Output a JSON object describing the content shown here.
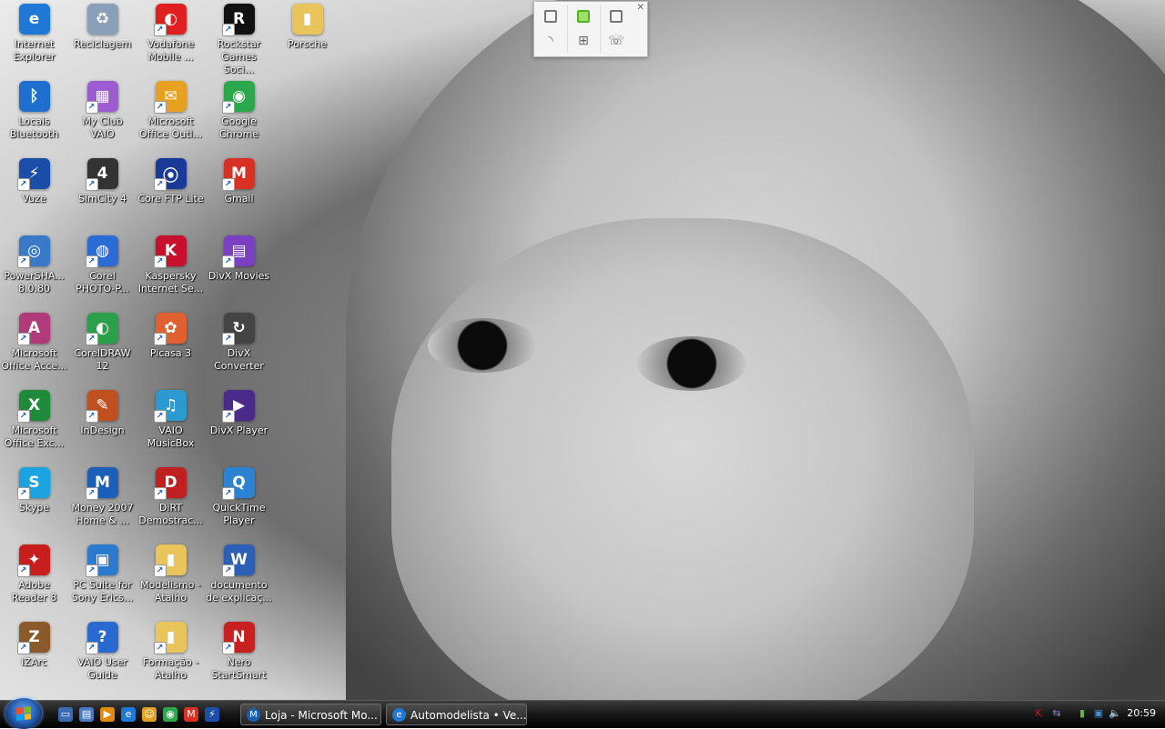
{
  "desktop": {
    "icons": [
      {
        "label": "Internet\nExplorer",
        "icon": "internet-explorer-icon",
        "glyph": "e",
        "color": "#1f77d6",
        "shortcut": false
      },
      {
        "label": "Reciclagem",
        "icon": "recycle-bin-icon",
        "glyph": "♻",
        "color": "#8aa0b8",
        "shortcut": false
      },
      {
        "label": "Vodafone\nMobile ...",
        "icon": "vodafone-icon",
        "glyph": "◐",
        "color": "#e02020",
        "shortcut": true
      },
      {
        "label": "Rockstar\nGames Soci...",
        "icon": "rockstar-icon",
        "glyph": "R",
        "color": "#111111",
        "shortcut": true
      },
      {
        "label": "Porsche",
        "icon": "folder-icon",
        "glyph": "▮",
        "color": "#e8c45a",
        "shortcut": false
      },
      {
        "label": "Locais\nBluetooth",
        "icon": "bluetooth-icon",
        "glyph": "ᛒ",
        "color": "#1e6fd0",
        "shortcut": false
      },
      {
        "label": "My Club\nVAIO",
        "icon": "my-club-vaio-icon",
        "glyph": "▦",
        "color": "#9c5bd0",
        "shortcut": true
      },
      {
        "label": "Microsoft\nOffice Outl...",
        "icon": "outlook-icon",
        "glyph": "✉",
        "color": "#e8a020",
        "shortcut": true
      },
      {
        "label": "Google\nChrome",
        "icon": "chrome-icon",
        "glyph": "◉",
        "color": "#2aa84a",
        "shortcut": true
      },
      {
        "label": "Vuze",
        "icon": "vuze-icon",
        "glyph": "⚡",
        "color": "#1b4ea8",
        "shortcut": true
      },
      {
        "label": "SimCity 4",
        "icon": "simcity-icon",
        "glyph": "4",
        "color": "#333333",
        "shortcut": true
      },
      {
        "label": "Core FTP Lite",
        "icon": "core-ftp-icon",
        "glyph": "⦿",
        "color": "#1a3a9a",
        "shortcut": true
      },
      {
        "label": "Gmail",
        "icon": "gmail-icon",
        "glyph": "M",
        "color": "#d93025",
        "shortcut": true
      },
      {
        "label": "PowerSHA...\n8.0.80",
        "icon": "powershare-icon",
        "glyph": "◎",
        "color": "#3a78c8",
        "shortcut": true
      },
      {
        "label": "Corel\nPHOTO-P...",
        "icon": "corel-photo-icon",
        "glyph": "◍",
        "color": "#2b6bd6",
        "shortcut": true
      },
      {
        "label": "Kaspersky\nInternet Se...",
        "icon": "kaspersky-icon",
        "glyph": "K",
        "color": "#c8102e",
        "shortcut": true
      },
      {
        "label": "DivX Movies",
        "icon": "divx-movies-icon",
        "glyph": "▤",
        "color": "#7b3fc2",
        "shortcut": true
      },
      {
        "label": "Microsoft\nOffice Acce...",
        "icon": "access-icon",
        "glyph": "A",
        "color": "#b03a7a",
        "shortcut": true
      },
      {
        "label": "CorelDRAW\n12",
        "icon": "coreldraw-icon",
        "glyph": "◐",
        "color": "#2aa04a",
        "shortcut": true
      },
      {
        "label": "Picasa 3",
        "icon": "picasa-icon",
        "glyph": "✿",
        "color": "#e06030",
        "shortcut": true
      },
      {
        "label": "DivX\nConverter",
        "icon": "divx-converter-icon",
        "glyph": "↻",
        "color": "#444444",
        "shortcut": true
      },
      {
        "label": "Microsoft\nOffice Exc...",
        "icon": "excel-icon",
        "glyph": "X",
        "color": "#1f8a3a",
        "shortcut": true
      },
      {
        "label": "InDesign",
        "icon": "indesign-icon",
        "glyph": "✎",
        "color": "#c05020",
        "shortcut": true
      },
      {
        "label": "VAIO\nMusicBox",
        "icon": "vaio-musicbox-icon",
        "glyph": "♫",
        "color": "#2a9ad0",
        "shortcut": true
      },
      {
        "label": "DivX Player",
        "icon": "divx-player-icon",
        "glyph": "▶",
        "color": "#4a2a8a",
        "shortcut": true
      },
      {
        "label": "Skype",
        "icon": "skype-icon",
        "glyph": "S",
        "color": "#1ba3e0",
        "shortcut": true
      },
      {
        "label": "Money 2007\nHome & ...",
        "icon": "money-icon",
        "glyph": "M",
        "color": "#1b5fb8",
        "shortcut": true
      },
      {
        "label": "DiRT\nDemostrac...",
        "icon": "dirt-icon",
        "glyph": "D",
        "color": "#c02020",
        "shortcut": true
      },
      {
        "label": "QuickTime\nPlayer",
        "icon": "quicktime-icon",
        "glyph": "Q",
        "color": "#2a82d0",
        "shortcut": true
      },
      {
        "label": "Adobe\nReader 8",
        "icon": "adobe-reader-icon",
        "glyph": "✦",
        "color": "#c81e1e",
        "shortcut": true
      },
      {
        "label": "PC Suite for\nSony Erics...",
        "icon": "pc-suite-icon",
        "glyph": "▣",
        "color": "#2a7ad0",
        "shortcut": true
      },
      {
        "label": "Modelismo -\nAtalho",
        "icon": "folder-shortcut-icon",
        "glyph": "▮",
        "color": "#e8c45a",
        "shortcut": true
      },
      {
        "label": "documento\nde explicaç...",
        "icon": "word-document-icon",
        "glyph": "W",
        "color": "#2b5fb8",
        "shortcut": true
      },
      {
        "label": "IZArc",
        "icon": "izarc-icon",
        "glyph": "Z",
        "color": "#8a5a2a",
        "shortcut": true
      },
      {
        "label": "VAIO User\nGuide",
        "icon": "vaio-guide-icon",
        "glyph": "?",
        "color": "#2a6ad0",
        "shortcut": true
      },
      {
        "label": "Formação -\nAtalho",
        "icon": "folder-shortcut-icon",
        "glyph": "▮",
        "color": "#e8c45a",
        "shortcut": true
      },
      {
        "label": "Nero\nStartSmart",
        "icon": "nero-icon",
        "glyph": "N",
        "color": "#c82020",
        "shortcut": true
      }
    ]
  },
  "gadget": {
    "top_icons": [
      "display-icon",
      "display-active-icon",
      "display-icon"
    ],
    "bottom_icons": [
      "wifi-icon",
      "network-icon",
      "phone-icon"
    ],
    "close_glyph": "✕",
    "accent_color": "#52b51e"
  },
  "taskbar": {
    "quick_launch": [
      {
        "icon": "show-desktop-icon",
        "color": "#3a6ab0",
        "glyph": "▭"
      },
      {
        "icon": "switch-windows-icon",
        "color": "#4a7ac0",
        "glyph": "▤"
      },
      {
        "icon": "media-player-icon",
        "color": "#e08a10",
        "glyph": "▶"
      },
      {
        "icon": "internet-explorer-icon",
        "color": "#1f77d6",
        "glyph": "e"
      },
      {
        "icon": "messenger-icon",
        "color": "#e0a020",
        "glyph": "☺"
      },
      {
        "icon": "chrome-icon",
        "color": "#2aa84a",
        "glyph": "◉"
      },
      {
        "icon": "gmail-icon",
        "color": "#d93025",
        "glyph": "M"
      },
      {
        "icon": "vuze-icon",
        "color": "#1b4ea8",
        "glyph": "⚡"
      }
    ],
    "windows": [
      {
        "label": "Loja - Microsoft Mo...",
        "icon": "money-icon",
        "color": "#1b5fb8",
        "glyph": "M"
      },
      {
        "label": "Automodelista • Ve...",
        "icon": "internet-explorer-icon",
        "color": "#1f77d6",
        "glyph": "e"
      }
    ],
    "tray": [
      {
        "icon": "kaspersky-icon",
        "color": "#c8102e",
        "glyph": "K"
      },
      {
        "icon": "sync-icon",
        "color": "#8a8ad0",
        "glyph": "⇆"
      },
      {
        "icon": "battery-icon",
        "color": "#6ab04a",
        "glyph": "▮"
      },
      {
        "icon": "network-tray-icon",
        "color": "#4a8ad0",
        "glyph": "▣"
      },
      {
        "icon": "volume-icon",
        "color": "#cccccc",
        "glyph": "🔈"
      }
    ],
    "clock": "20:59"
  }
}
